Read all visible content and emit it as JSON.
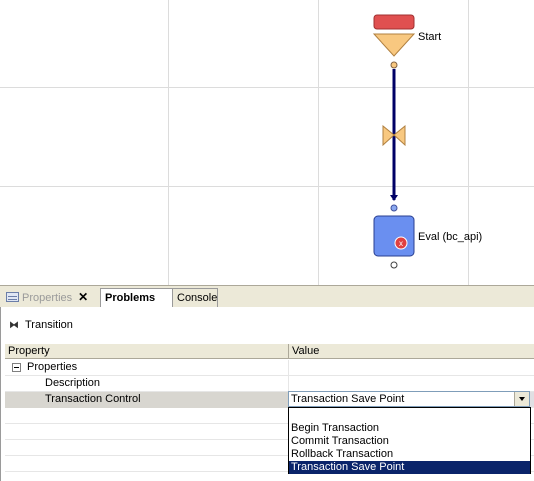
{
  "diagram": {
    "nodes": [
      {
        "id": "start",
        "label": "Start",
        "icon": "start-icon"
      },
      {
        "id": "eval",
        "label": "Eval (bc_api)",
        "icon": "eval-node-icon",
        "badge_icon": "error-x-icon"
      }
    ],
    "transition_icon": "bowtie-transition-icon",
    "colors": {
      "connector": "#000066",
      "start_top": "#e05050",
      "start_triangle": "#f8c880",
      "eval_fill": "#6a8ff0",
      "error_badge": "#e04040"
    }
  },
  "tabs": [
    {
      "label": "Properties",
      "icon": "properties-icon",
      "closable": true,
      "active": false
    },
    {
      "label": "Problems",
      "active": true
    },
    {
      "label": "Console",
      "active": false
    }
  ],
  "panel": {
    "title": "Transition",
    "title_icon": "transition-icon",
    "columns": [
      "Property",
      "Value"
    ],
    "rows": [
      {
        "name": "Properties",
        "value": "",
        "expander": "collapse"
      },
      {
        "name": "Description",
        "value": ""
      },
      {
        "name": "Transaction Control",
        "value": "Transaction Save Point",
        "selected": true
      }
    ],
    "combo": {
      "selected": "Transaction Save Point",
      "options": [
        "",
        "Begin Transaction",
        "Commit Transaction",
        "Rollback Transaction",
        "Transaction Save Point"
      ],
      "highlighted": "Transaction Save Point"
    }
  }
}
